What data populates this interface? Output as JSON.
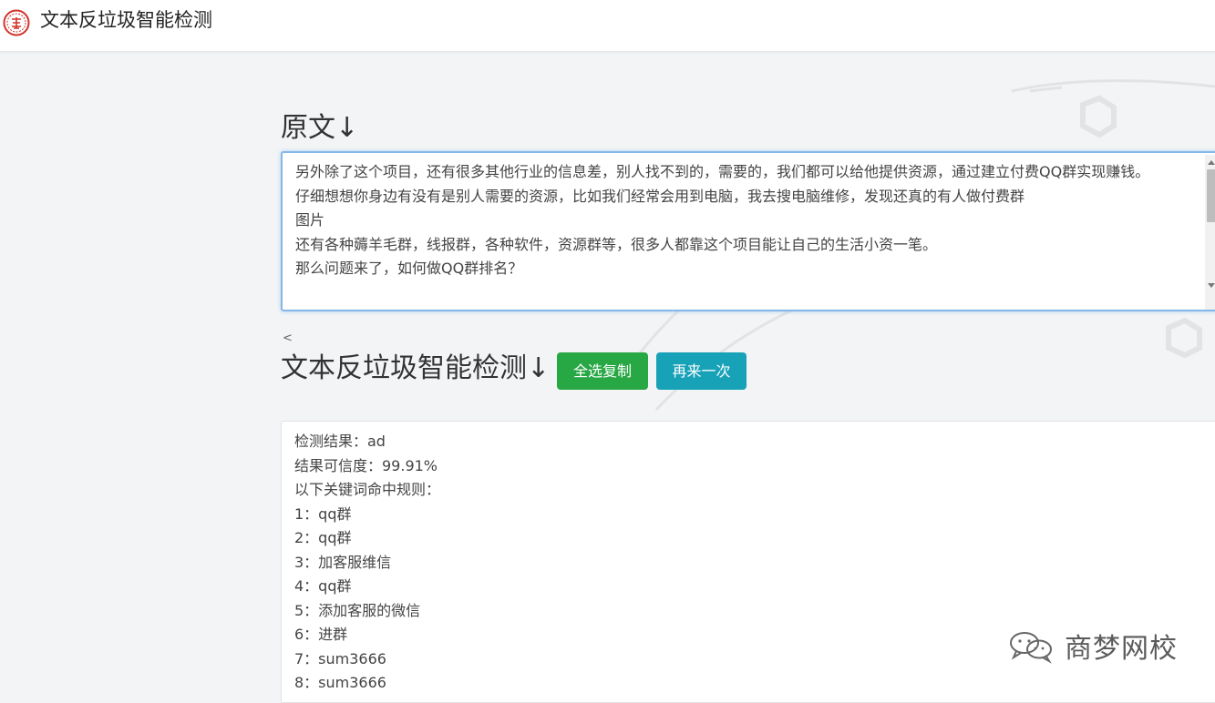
{
  "header": {
    "title": "文本反垃圾智能检测"
  },
  "original": {
    "heading": "原文↓",
    "text": "另外除了这个项目，还有很多其他行业的信息差，别人找不到的，需要的，我们都可以给他提供资源，通过建立付费QQ群实现赚钱。\n仔细想想你身边有没有是别人需要的资源，比如我们经常会用到电脑，我去搜电脑维修，发现还真的有人做付费群\n图片\n还有各种薅羊毛群，线报群，各种软件，资源群等，很多人都靠这个项目能让自己的生活小资一笔。\n那么问题来了，如何做QQ群排名？"
  },
  "detect": {
    "lt_mark": "<",
    "heading": "文本反垃圾智能检测↓",
    "copy_button": "全选复制",
    "retry_button": "再来一次"
  },
  "result": {
    "lines": [
      "检测结果：ad",
      "结果可信度：99.91%",
      "以下关键词命中规则：",
      "1：qq群",
      "2：qq群",
      "3：加客服维信",
      "4：qq群",
      "5：添加客服的微信",
      "6：进群",
      "7：sum3666",
      "8：sum3666"
    ]
  },
  "watermark": {
    "text": "商梦网校"
  },
  "colors": {
    "copy_button": "#28a745",
    "retry_button": "#17a2b8",
    "focus_border": "#86b7e8",
    "logo_red": "#d0342c"
  }
}
